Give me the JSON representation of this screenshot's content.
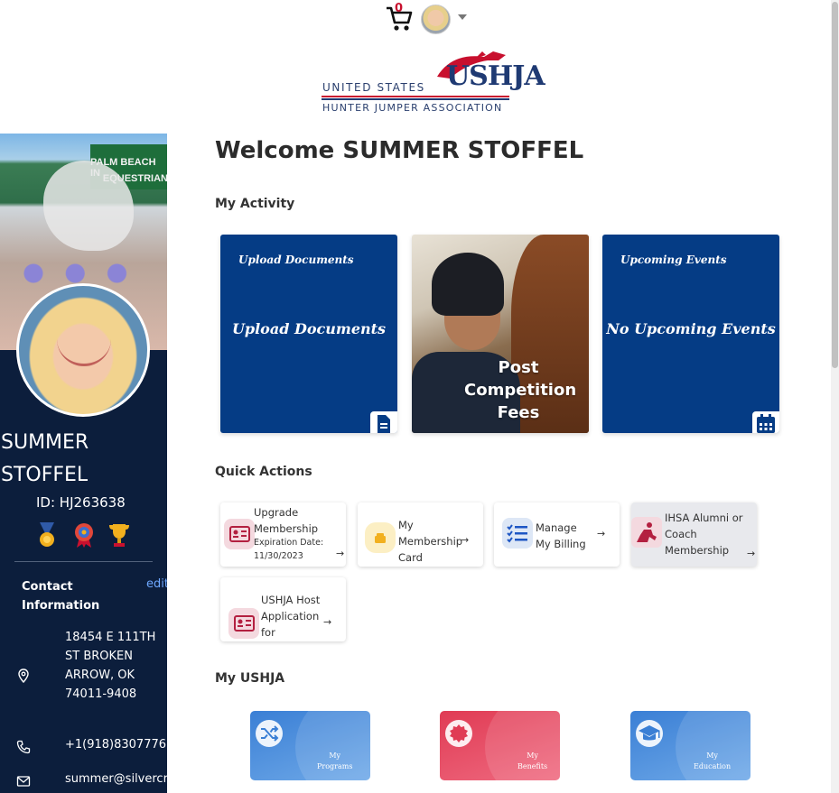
{
  "header": {
    "cart_count": "0",
    "logo": {
      "line1": "UNITED STATES",
      "line2": "HUNTER JUMPER ASSOCIATION",
      "mark": "USHJA"
    }
  },
  "sidebar": {
    "cover_banner_line1": "PALM BEACH IN",
    "cover_banner_line2": "EQUESTRIAN",
    "name_first": "SUMMER",
    "name_last": "STOFFEL",
    "id_text": "ID: HJ263638",
    "contact_title": "Contact Information",
    "edit_label": "edit",
    "address": "18454 E 111TH ST BROKEN ARROW, OK 74011-9408",
    "phone": "+1(918)8307776",
    "email": "summer@silvercr"
  },
  "main": {
    "welcome": "Welcome SUMMER STOFFEL",
    "my_activity_title": "My Activity",
    "activity_cards": [
      {
        "small": "Upload Documents",
        "big": "Upload Documents"
      },
      {
        "overlay": "Post Competition Fees"
      },
      {
        "small": "Upcoming Events",
        "big": "No Upcoming Events"
      }
    ],
    "quick_actions_title": "Quick Actions",
    "quick_actions": [
      {
        "label": "Upgrade Membership",
        "sub": "Expiration Date: 11/30/2023"
      },
      {
        "label": "My Membership Card"
      },
      {
        "label": "Manage My Billing"
      },
      {
        "label": "IHSA Alumni or Coach Membership"
      },
      {
        "label": "USHJA Host Application for"
      }
    ],
    "arrow": "→",
    "my_ushja_title": "My USHJA",
    "my_cards": [
      {
        "line1": "My",
        "line2": "Programs"
      },
      {
        "line1": "My",
        "line2": "Benefits"
      },
      {
        "line1": "My",
        "line2": "Education"
      }
    ]
  },
  "colors": {
    "sidebar_bg": "#0c1e3c",
    "card_blue": "#053c85",
    "accent_red": "#c8102e",
    "link": "#6ea8ff"
  },
  "icons": [
    "cart-icon",
    "chevron-down-icon",
    "document-icon",
    "calendar-icon",
    "id-card-icon",
    "wallet-icon",
    "list-icon",
    "rider-icon",
    "shuffle-icon",
    "badge-icon",
    "graduation-cap-icon",
    "map-pin-icon",
    "phone-icon",
    "mail-icon"
  ]
}
